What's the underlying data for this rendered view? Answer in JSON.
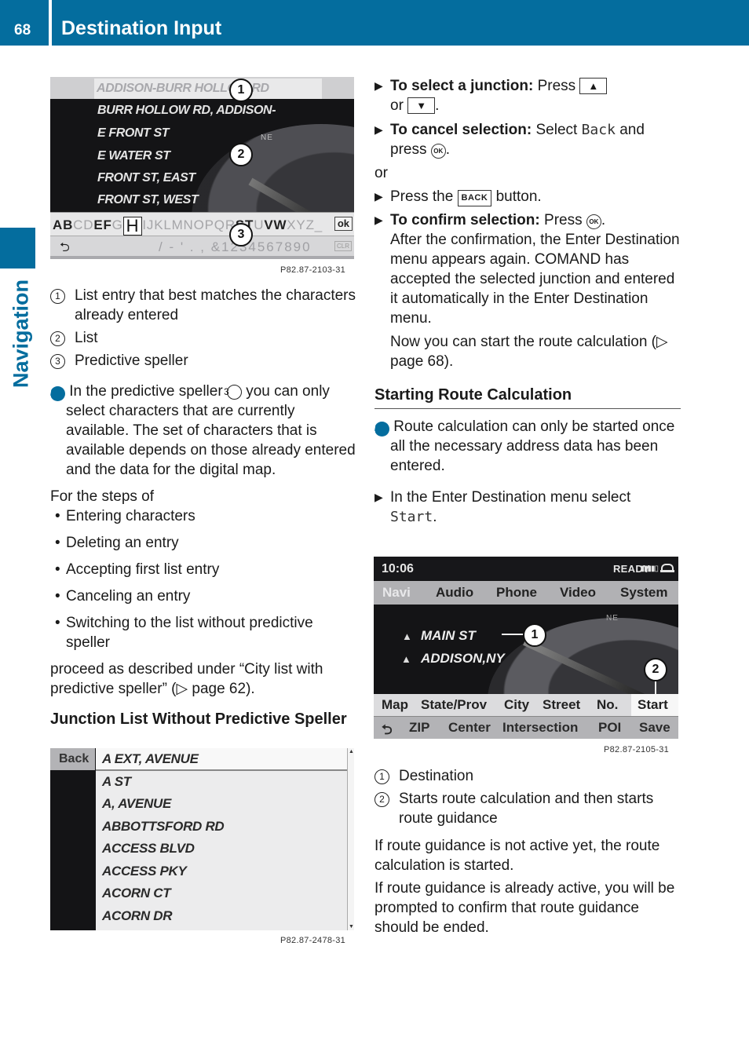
{
  "header": {
    "page_number": "68",
    "title": "Destination Input"
  },
  "side_tab": {
    "label": "Navigation"
  },
  "left": {
    "screenshot1": {
      "top_entry": "ADDISON-BURR HOLLOW RD",
      "list": [
        "BURR HOLLOW RD, ADDISON-",
        "E FRONT ST",
        "E WATER ST",
        "FRONT ST, EAST",
        "FRONT ST, WEST"
      ],
      "compass_label": "NE",
      "speller_chars": [
        {
          "c": "AB",
          "on": true
        },
        {
          "c": "CD",
          "on": false
        },
        {
          "c": "EF",
          "on": true
        },
        {
          "c": "G",
          "on": false
        },
        {
          "c": "H",
          "sel": true
        },
        {
          "c": "IJKLMNOPQR",
          "on": false
        },
        {
          "c": "ST",
          "on": true
        },
        {
          "c": "U",
          "on": false
        },
        {
          "c": "VW",
          "on": true
        },
        {
          "c": "XYZ_",
          "on": false
        }
      ],
      "ok_key": "ok",
      "back_symbol": "⮌",
      "number_chars": "/ - ' . , &1234567890",
      "clr_key": "CLR",
      "callouts": [
        "1",
        "2",
        "3"
      ],
      "code": "P82.87-2103-31"
    },
    "legend": [
      {
        "num": "1",
        "text": "List entry that best matches the characters already entered"
      },
      {
        "num": "2",
        "text": "List"
      },
      {
        "num": "3",
        "text": "Predictive speller"
      }
    ],
    "info": {
      "icon": "i",
      "before": "In the predictive speller",
      "ref": "3",
      "after": "you can only select characters that are currently available. The set of characters that is available depends on those already entered and the data for the digital map."
    },
    "steps_intro": "For the steps of",
    "steps": [
      "Entering characters",
      "Deleting an entry",
      "Accepting first list entry",
      "Canceling an entry",
      "Switching to the list without predictive speller"
    ],
    "proceed_text": "proceed as described under “City list with predictive speller” (▷ page 62).",
    "junction_heading": "Junction List Without Predictive Speller",
    "screenshot2": {
      "back_label": "Back",
      "list": [
        "A EXT, AVENUE",
        "A ST",
        "A, AVENUE",
        "ABBOTTSFORD RD",
        "ACCESS BLVD",
        "ACCESS PKY",
        "ACORN CT",
        "ACORN DR"
      ],
      "code": "P82.87-2478-31"
    }
  },
  "right": {
    "select_junction": {
      "label": "To select a junction:",
      "text": "Press",
      "key_up": "▲",
      "or": "or",
      "key_down": "▼",
      "end": "."
    },
    "cancel_selection": {
      "label": "To cancel selection:",
      "text1": "Select",
      "back_word": "Back",
      "text2": "and press",
      "ok": "OK",
      "end": "."
    },
    "or": "or",
    "press_back": {
      "text1": "Press the",
      "key": "BACK",
      "text2": "button."
    },
    "confirm_selection": {
      "label": "To confirm selection:",
      "text": "Press",
      "ok": "OK",
      "end": "."
    },
    "confirm_para1": "After the confirmation, the Enter Destination menu appears again. COMAND has accepted the selected junction and entered it automatically in the Enter Destination menu.",
    "confirm_para2": "Now you can start the route calculation (▷ page 68).",
    "section_heading": "Starting Route Calculation",
    "info2": {
      "icon": "i",
      "text": "Route calculation can only be started once all the necessary address data has been entered."
    },
    "step_start": {
      "text": "In the Enter Destination menu select",
      "menu_word": "Start",
      "end": "."
    },
    "screenshot3": {
      "time": "10:06",
      "status": "READY",
      "signal": "▮▮▮▮▯",
      "menu": [
        "Navi",
        "Audio",
        "Phone",
        "Video",
        "System"
      ],
      "active_menu": "Navi",
      "compass_label": "NE",
      "destination_street": "MAIN ST",
      "destination_city": "ADDISON,NY",
      "row1": [
        "Map",
        "State/Prov",
        "City",
        "Street",
        "No.",
        "Start"
      ],
      "row2": [
        "⮌",
        "ZIP",
        "Center",
        "Intersection",
        "POI",
        "Save"
      ],
      "callouts": [
        "1",
        "2"
      ],
      "code": "P82.87-2105-31"
    },
    "legend": [
      {
        "num": "1",
        "text": "Destination"
      },
      {
        "num": "2",
        "text": "Starts route calculation and then starts route guidance"
      }
    ],
    "para1": "If route guidance is not active yet, the route calculation is started.",
    "para2": "If route guidance is already active, you will be prompted to confirm that route guidance should be ended."
  },
  "colors": {
    "brand_blue": "#046d9e"
  }
}
